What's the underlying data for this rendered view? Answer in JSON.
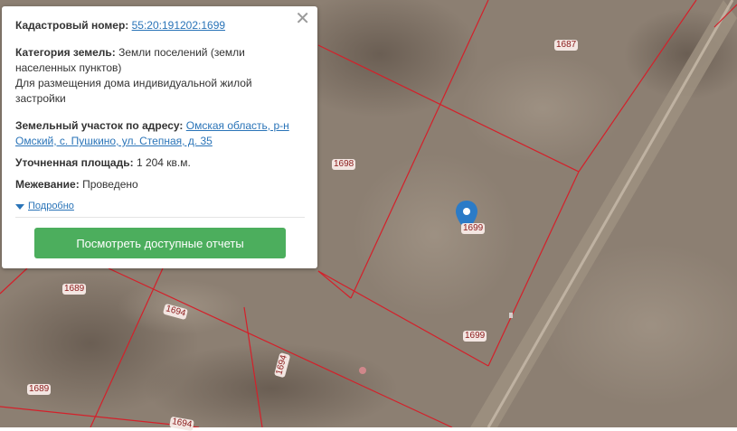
{
  "popup": {
    "cadastral_label": "Кадастровый номер:",
    "cadastral_number": "55:20:191202:1699",
    "category_label": "Категория земель:",
    "category_value": "Земли поселений (земли населенных пунктов)",
    "category_use": "Для размещения дома индивидуальной жилой застройки",
    "address_label": "Земельный участок по адресу:",
    "address_value": "Омская область, р-н Омский, с. Пушкино, ул. Степная, д. 35",
    "area_label": "Уточненная площадь:",
    "area_value": "1 204 кв.м.",
    "survey_label": "Межевание:",
    "survey_value": "Проведено",
    "details_link": "Подробно",
    "button_label": "Посмотреть доступные отчеты",
    "close_icon": "close-icon"
  },
  "map": {
    "parcel_labels": [
      "1687",
      "1698",
      "1699",
      "1699",
      "1689",
      "1694",
      "1694",
      "1689",
      "1694"
    ],
    "line_color": "#d4202a",
    "marker_color": "#2b7bc7"
  }
}
